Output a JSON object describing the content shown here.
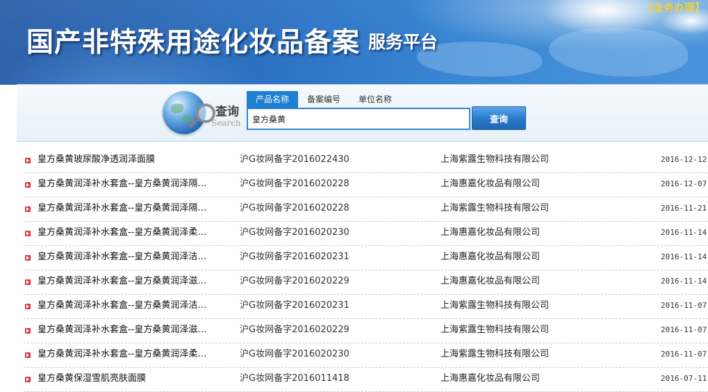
{
  "header": {
    "title": "国产非特殊用途化妆品备案",
    "subtitle": "服务平台",
    "biz_link": "【业务办理】"
  },
  "search": {
    "label": "查询",
    "label_en": "Search",
    "tabs": [
      {
        "label": "产品名称",
        "active": true
      },
      {
        "label": "备案编号",
        "active": false
      },
      {
        "label": "单位名称",
        "active": false
      }
    ],
    "input_value": "皇方桑黄",
    "button_label": "查询"
  },
  "results": [
    {
      "name": "皇方桑黄玻尿酸净透润泽面膜",
      "record_no": "沪G妆网备字2016022430",
      "unit": "上海紫露生物科技有限公司",
      "date": "2016-12-12"
    },
    {
      "name": "皇方桑黄润泽补水套盒--皇方桑黄润泽隔…",
      "record_no": "沪G妆网备字2016020228",
      "unit": "上海惠嘉化妆品有限公司",
      "date": "2016-12-07"
    },
    {
      "name": "皇方桑黄润泽补水套盒--皇方桑黄润泽隔…",
      "record_no": "沪G妆网备字2016020228",
      "unit": "上海紫露生物科技有限公司",
      "date": "2016-11-21"
    },
    {
      "name": "皇方桑黄润泽补水套盒--皇方桑黄润泽柔…",
      "record_no": "沪G妆网备字2016020230",
      "unit": "上海惠嘉化妆品有限公司",
      "date": "2016-11-14"
    },
    {
      "name": "皇方桑黄润泽补水套盒--皇方桑黄润泽洁…",
      "record_no": "沪G妆网备字2016020231",
      "unit": "上海惠嘉化妆品有限公司",
      "date": "2016-11-14"
    },
    {
      "name": "皇方桑黄润泽补水套盒--皇方桑黄润泽滋…",
      "record_no": "沪G妆网备字2016020229",
      "unit": "上海惠嘉化妆品有限公司",
      "date": "2016-11-14"
    },
    {
      "name": "皇方桑黄润泽补水套盒--皇方桑黄润泽洁…",
      "record_no": "沪G妆网备字2016020231",
      "unit": "上海紫露生物科技有限公司",
      "date": "2016-11-07"
    },
    {
      "name": "皇方桑黄润泽补水套盒--皇方桑黄润泽滋…",
      "record_no": "沪G妆网备字2016020229",
      "unit": "上海紫露生物科技有限公司",
      "date": "2016-11-07"
    },
    {
      "name": "皇方桑黄润泽补水套盒--皇方桑黄润泽柔…",
      "record_no": "沪G妆网备字2016020230",
      "unit": "上海紫露生物科技有限公司",
      "date": "2016-11-07"
    },
    {
      "name": "皇方桑黄保湿雪肌亮肤面膜",
      "record_no": "沪G妆网备字2016011418",
      "unit": "上海惠嘉化妆品有限公司",
      "date": "2016-07-11"
    }
  ],
  "icons": {
    "bullet": "red-arrow-bullet-icon",
    "search_globe": "globe-magnifier-icon"
  },
  "colors": {
    "banner_blue": "#2a6fc0",
    "tab_active": "#1f7fd1",
    "button_blue": "#2c7bcb",
    "bullet_red": "#d9343a",
    "biz_link_yellow": "#f0d040"
  }
}
